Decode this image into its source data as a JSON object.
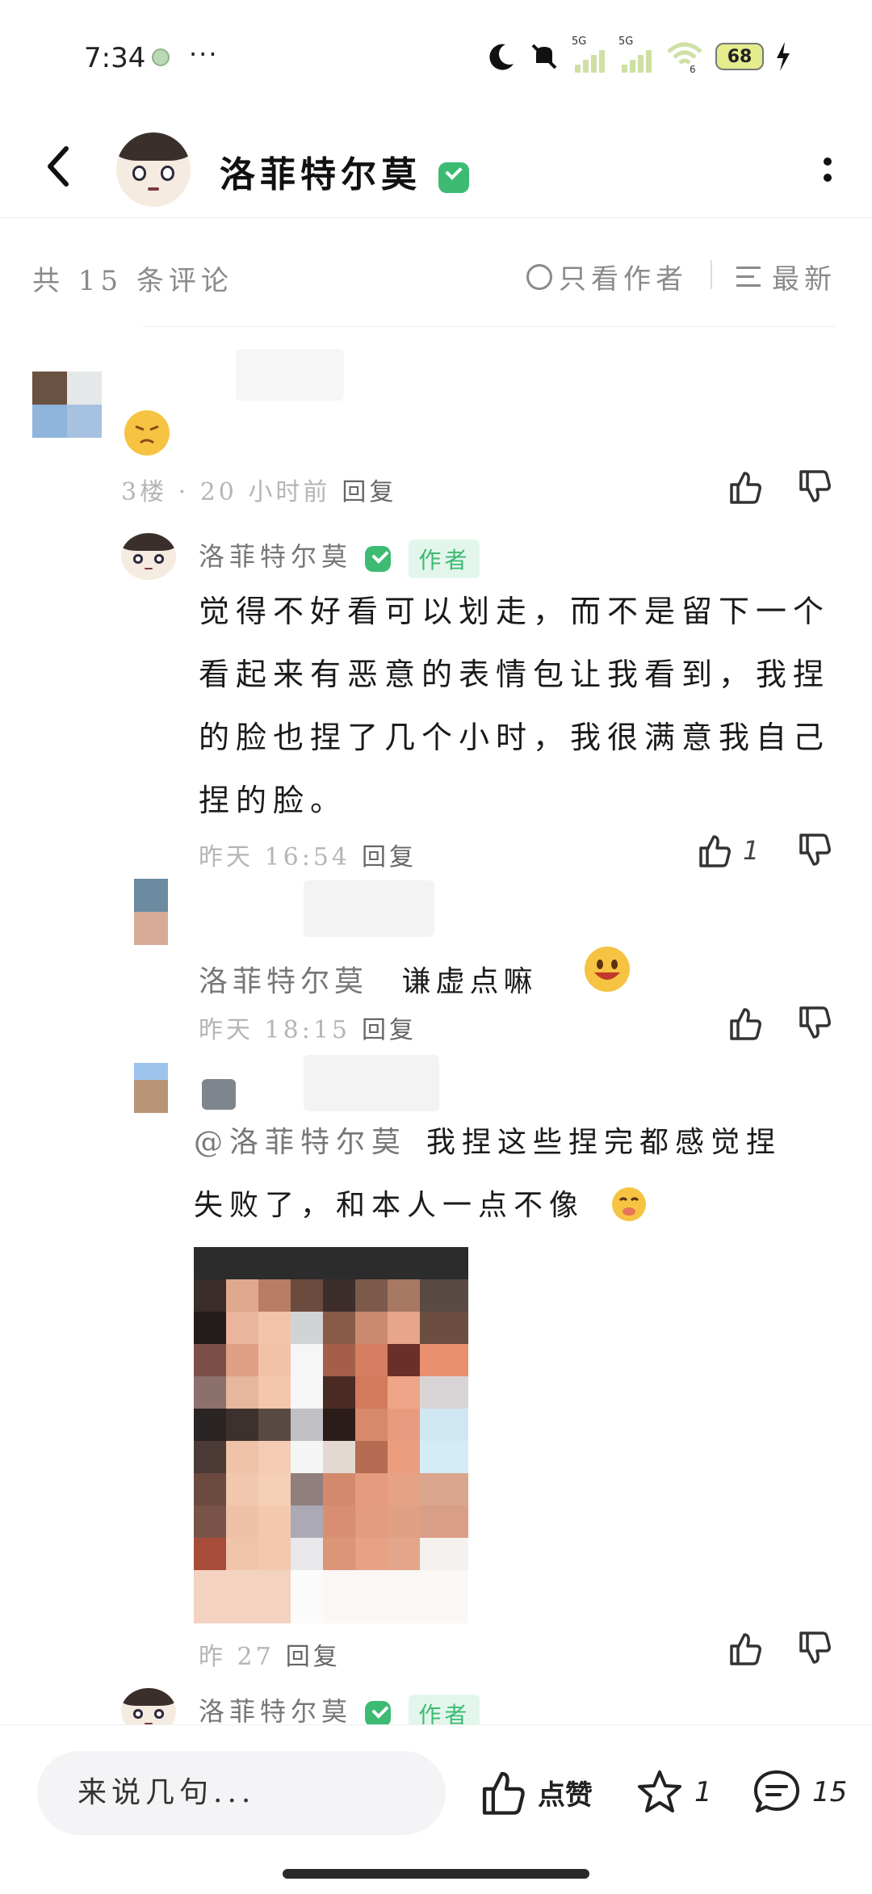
{
  "status": {
    "time": "7:34",
    "more": "···",
    "signal1": "5G",
    "signal2": "5G",
    "wifi_sub": "6",
    "battery": "68"
  },
  "header": {
    "title": "洛菲特尔莫"
  },
  "filter": {
    "count_label": "共 15 条评论",
    "author_only": "只看作者",
    "sort": "最新"
  },
  "comments": [
    {
      "meta_time": "3楼 · 20 小时前",
      "reply": "回复"
    },
    {
      "name": "洛菲特尔莫",
      "tag": "作者",
      "lines": [
        "觉得不好看可以划走，而不是留下一个",
        "看起来有恶意的表情包让我看到，我捏",
        "的脸也捏了几个小时，我很满意我自己",
        "捏的脸。"
      ],
      "meta_time": "昨天 16:54",
      "reply": "回复",
      "likes": "1"
    },
    {
      "mention": "洛菲特尔莫",
      "text": "谦虚点嘛",
      "meta_time": "昨天 18:15",
      "reply": "回复"
    },
    {
      "mention": "@洛菲特尔莫",
      "line1": "我捏这些捏完都感觉捏",
      "line2": "失败了，和本人一点不像",
      "meta_time": "昨 27",
      "reply": "回复"
    },
    {
      "name": "洛菲特尔莫",
      "tag": "作者"
    }
  ],
  "bottom": {
    "placeholder": "来说几句...",
    "like_label": "点赞",
    "star_count": "1",
    "comment_count": "15"
  },
  "colors": {
    "accent_green": "#3dbb73",
    "meta_grey": "#b5b5b5"
  }
}
